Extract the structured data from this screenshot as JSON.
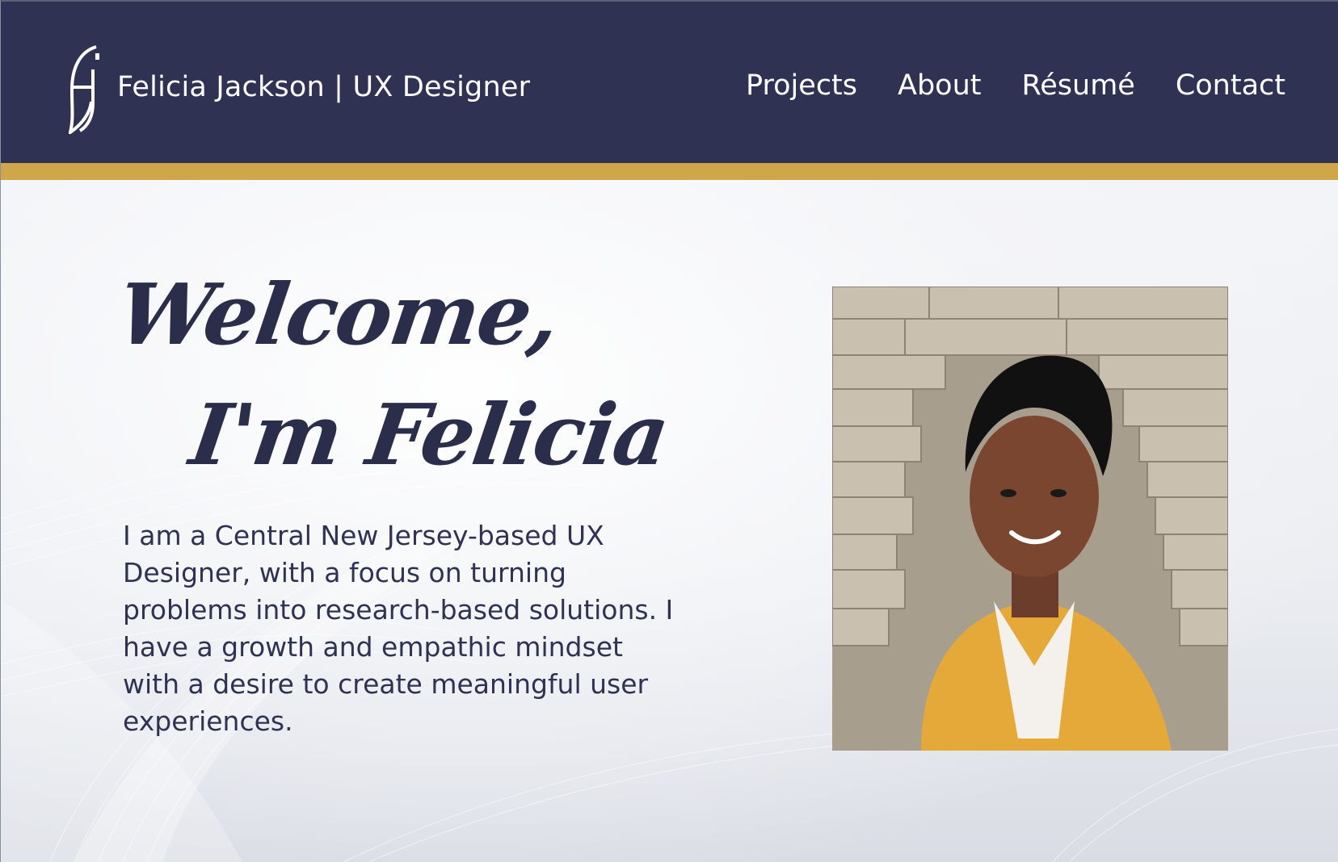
{
  "header": {
    "brand": "Felicia Jackson | UX Designer",
    "logo_icon": "fj-monogram-icon",
    "nav": [
      "Projects",
      "About",
      "Résumé",
      "Contact"
    ]
  },
  "hero": {
    "greeting_line1": "Welcome,",
    "greeting_line2": "I'm Felicia",
    "intro": "I am a Central New Jersey-based UX Designer, with a focus on turning problems into research-based solutions. I have a growth and empathic mindset with a desire to create meaningful user experiences.",
    "photo": "profile-photo"
  },
  "colors": {
    "navy": "#2f3253",
    "gold": "#cfa64a",
    "text": "#2b2e4a",
    "white": "#ffffff"
  }
}
